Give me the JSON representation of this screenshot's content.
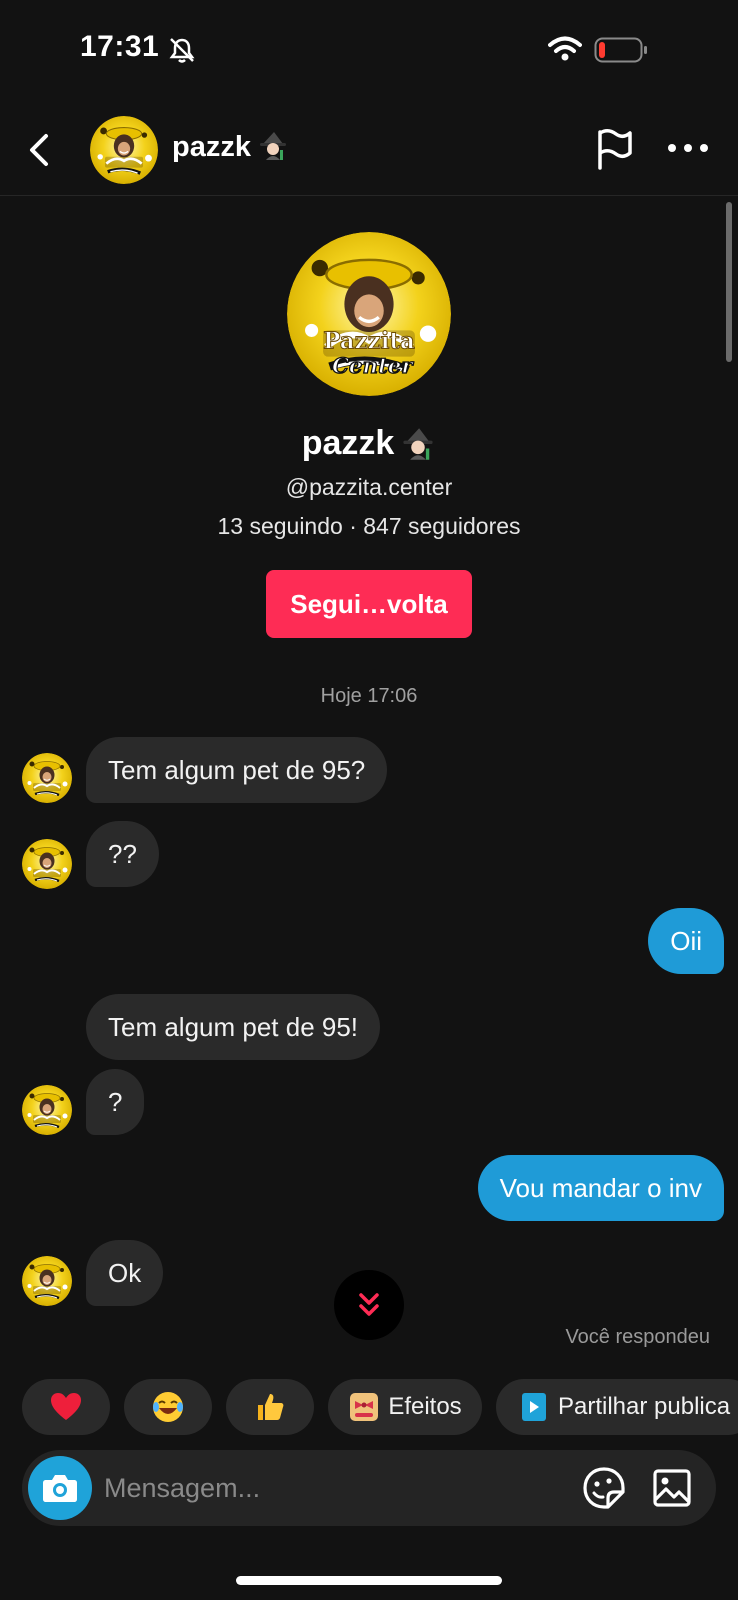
{
  "status_bar": {
    "time": "17:31"
  },
  "header": {
    "name": "pazzk",
    "icons": [
      "back-icon",
      "flag-icon",
      "more-icon"
    ]
  },
  "profile": {
    "name": "pazzk",
    "handle": "@pazzita.center",
    "stats": "13 seguindo · 847 seguidores",
    "follow_button": "Segui…volta",
    "avatar_text": {
      "line1": "Pazzita",
      "line2": "Center"
    }
  },
  "chat": {
    "timestamp": "Hoje 17:06",
    "messages": [
      {
        "from": "them",
        "text": "Tem algum pet de 95?"
      },
      {
        "from": "them",
        "text": "??"
      },
      {
        "from": "me",
        "text": "Oii"
      },
      {
        "from": "them",
        "text": "Tem algum pet de 95!"
      },
      {
        "from": "them",
        "text": "?"
      },
      {
        "from": "me",
        "text": "Vou mandar o inv"
      },
      {
        "from": "them",
        "text": "Ok"
      }
    ],
    "replied_note": "Você respondeu"
  },
  "quick_replies": [
    {
      "icon": "heart-emoji"
    },
    {
      "icon": "laughing-emoji"
    },
    {
      "icon": "thumbs-up-emoji"
    },
    {
      "icon": "effects-icon",
      "label": "Efeitos"
    },
    {
      "icon": "share-post-icon",
      "label": "Partilhar publica"
    }
  ],
  "composer": {
    "placeholder": "Mensagem..."
  },
  "colors": {
    "accent_red": "#fe2c55",
    "outgoing_bubble": "#1f9bd7",
    "background": "#121212"
  }
}
